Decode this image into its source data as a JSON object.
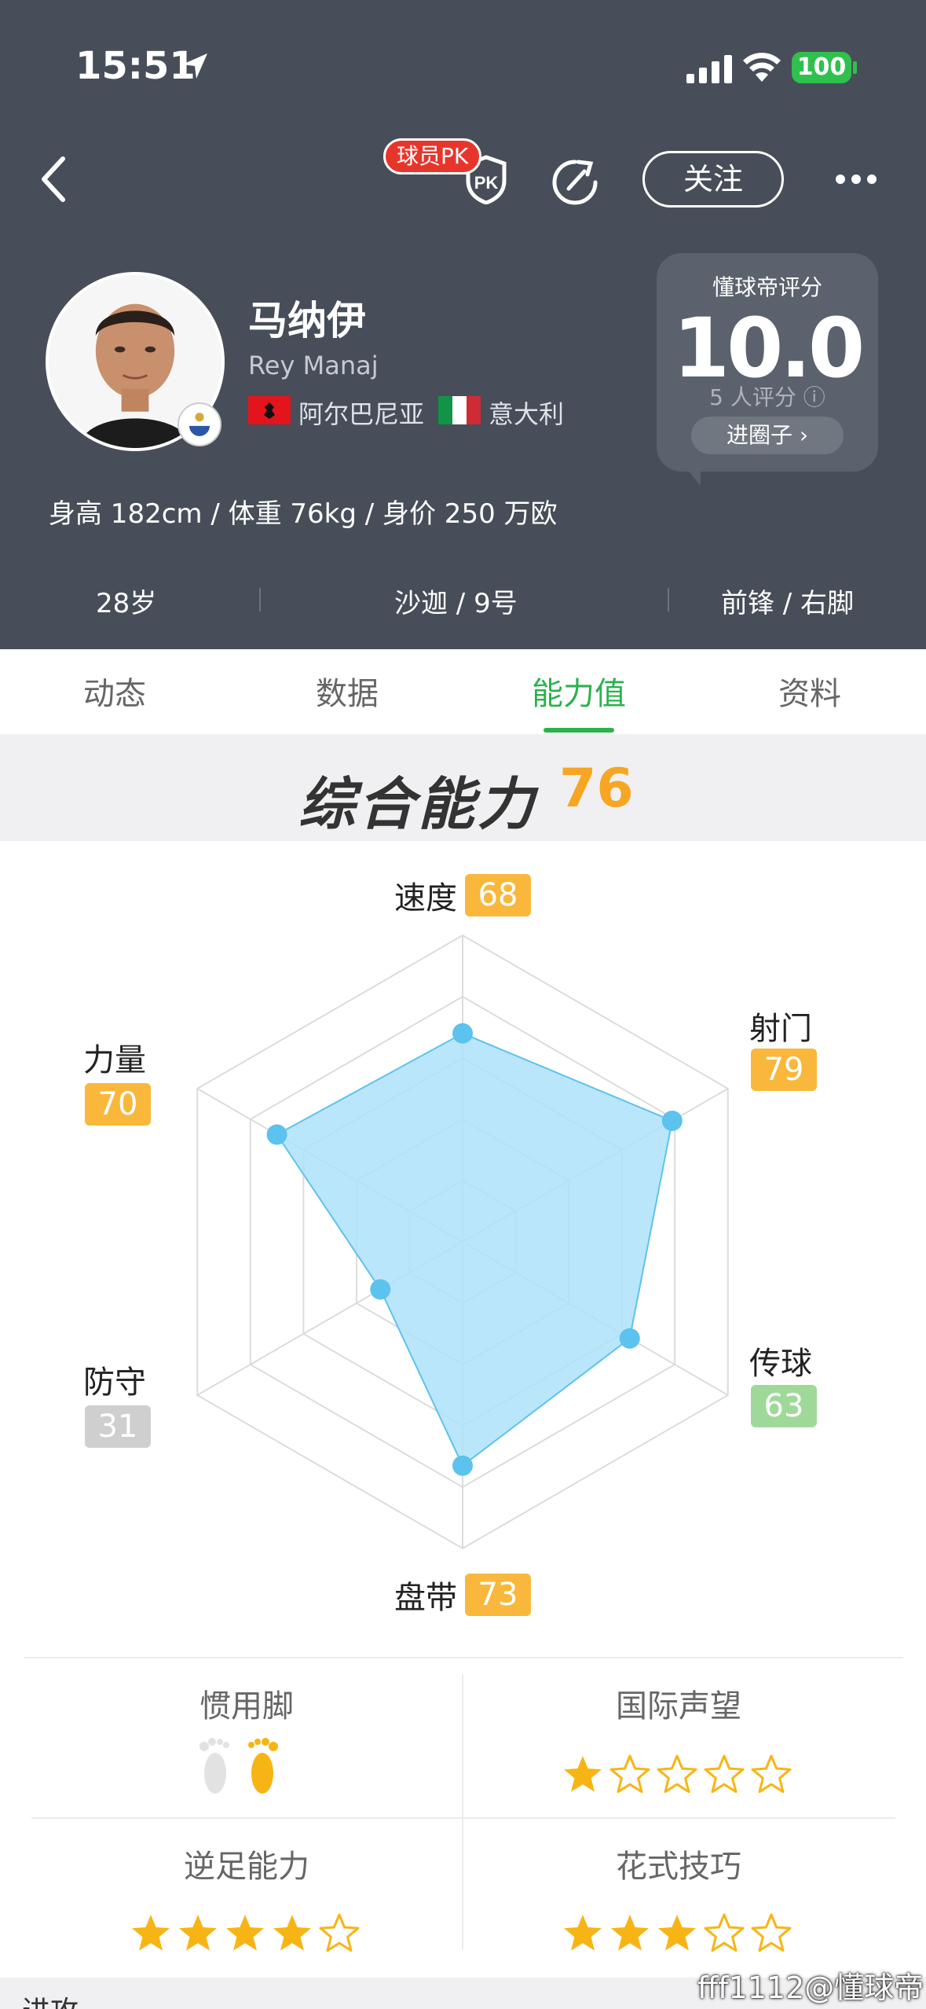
{
  "status_bar": {
    "time": "15:51",
    "battery": "100"
  },
  "nav": {
    "pk_label": "球员PK",
    "pk_icon_text": "PK",
    "follow_label": "关注"
  },
  "player": {
    "name_cn": "马纳伊",
    "name_en": "Rey Manaj",
    "nationality_1": "阿尔巴尼亚",
    "nationality_2": "意大利",
    "physical": "身高 182cm / 体重 76kg / 身价 250 万欧",
    "age": "28岁",
    "club_number": "沙迦 / 9号",
    "position_foot": "前锋 / 右脚"
  },
  "rating": {
    "label": "懂球帝评分",
    "score": "10.0",
    "count": "5 人评分",
    "button": "进圈子 ›"
  },
  "tabs": [
    "动态",
    "数据",
    "能力值",
    "资料"
  ],
  "active_tab": 2,
  "overall": {
    "title": "综合能力",
    "value": "76"
  },
  "chart_data": {
    "type": "radar",
    "max": 100,
    "axes": [
      {
        "label": "速度",
        "value": 68,
        "badge_color": "#f9b83c"
      },
      {
        "label": "射门",
        "value": 79,
        "badge_color": "#f9b83c"
      },
      {
        "label": "传球",
        "value": 63,
        "badge_color": "#9fd99a"
      },
      {
        "label": "盘带",
        "value": 73,
        "badge_color": "#f9b83c"
      },
      {
        "label": "防守",
        "value": 31,
        "badge_color": "#cfcfcf"
      },
      {
        "label": "力量",
        "value": 70,
        "badge_color": "#f9b83c"
      }
    ],
    "fill_color": "#aee2fb",
    "stroke_color": "#5cc2ee",
    "point_color": "#5cc2ee"
  },
  "traits": {
    "preferred_foot_label": "惯用脚",
    "preferred_foot": "right",
    "reputation_label": "国际声望",
    "reputation_stars": 1,
    "weak_foot_label": "逆足能力",
    "weak_foot_stars": 4,
    "skill_moves_label": "花式技巧",
    "skill_moves_stars": 3,
    "max_stars": 5
  },
  "footer": {
    "next_section": "进攻",
    "watermark": "fff1112@懂球帝"
  }
}
